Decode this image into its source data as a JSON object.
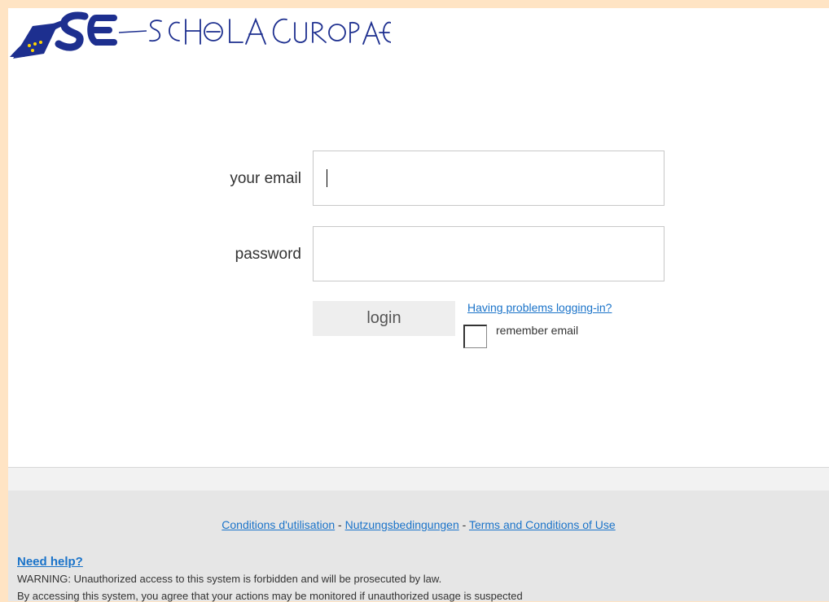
{
  "logo": {
    "text": "SCHOLA EUROPAEA",
    "mark": "SE",
    "colors": {
      "blue": "#1d2f8f",
      "star": "#ffd400"
    }
  },
  "login": {
    "email_label": "your email",
    "email_value": "",
    "password_label": "password",
    "password_value": "",
    "login_button": "login",
    "problems_link": "Having problems logging-in?",
    "remember_label": "remember email",
    "remember_checked": false
  },
  "footer": {
    "terms_fr": "Conditions d'utilisation",
    "separator_1": " - ",
    "terms_de": "Nutzungsbedingungen",
    "separator_2": " - ",
    "terms_en": "Terms and Conditions of Use",
    "need_help": "Need help?",
    "warning_1": "WARNING: Unauthorized access to this system is forbidden and will be prosecuted by law.",
    "warning_2": "By accessing this system, you agree that your actions may be monitored if unauthorized usage is suspected"
  },
  "colors": {
    "side_background": "#ffe4c4",
    "link": "#1a73c9",
    "footer_background": "#e6e6e6"
  }
}
